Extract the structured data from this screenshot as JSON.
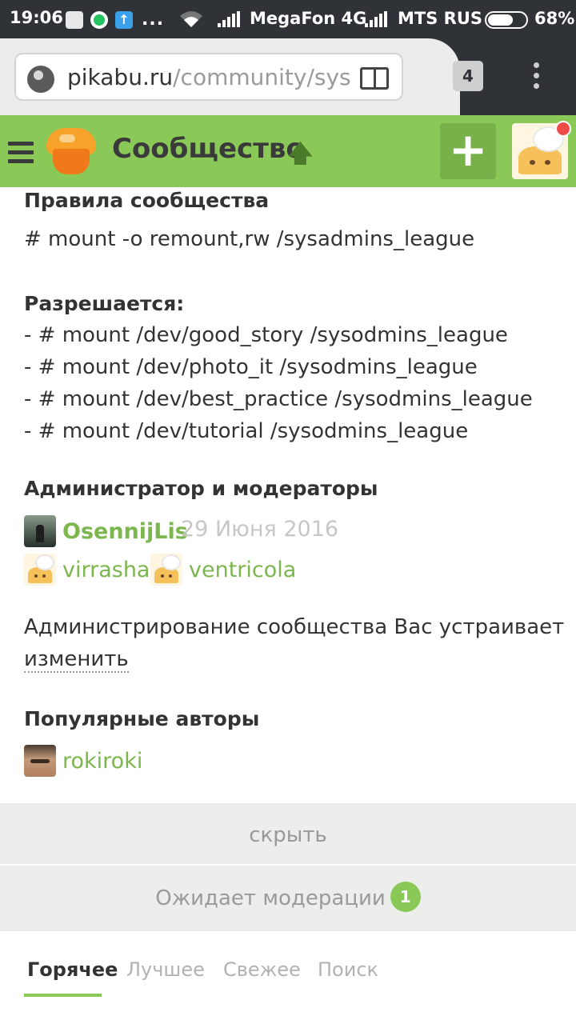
{
  "status_bar": {
    "time": "19:06",
    "more_indicator": "...",
    "operator1": "MegaFon 4G",
    "operator2": "MTS RUS",
    "battery_percent": "68%",
    "battery_level": 0.68
  },
  "browser": {
    "url_host": "pikabu.ru",
    "url_path": "/community/sysc",
    "tab_count": "4"
  },
  "header": {
    "title": "Сообщество",
    "title_arrow": "🡅",
    "add_label": "+"
  },
  "rules": {
    "heading": "Правила сообщества",
    "command": "# mount -o remount,rw /sysadmins_league",
    "allowed_heading": "Разрешается:",
    "allowed_items": [
      "- # mount /dev/good_story /sysodmins_league",
      "- # mount /dev/photo_it /sysodmins_league",
      "- # mount /dev/best_practice /sysodmins_league",
      "- # mount /dev/tutorial /sysodmins_league"
    ]
  },
  "admins": {
    "heading": "Администратор и модераторы",
    "admin": {
      "name": "OsennijLis",
      "date": "29 Июня 2016"
    },
    "moderators": [
      "virrasha",
      "ventricola"
    ],
    "satisfaction_text": "Администрирование сообщества Вас устраивает",
    "change_link": "изменить"
  },
  "popular": {
    "heading": "Популярные авторы",
    "authors": [
      "rokiroki"
    ]
  },
  "panels": {
    "hide_label": "скрыть",
    "moderation_label": "Ожидает модерации",
    "moderation_count": "1"
  },
  "tabs": [
    {
      "label": "Горячее",
      "active": true
    },
    {
      "label": "Лучшее",
      "active": false
    },
    {
      "label": "Свежее",
      "active": false
    },
    {
      "label": "Поиск",
      "active": false
    }
  ],
  "colors": {
    "brand_green": "#8ac858",
    "link_green": "#7cb64e",
    "notification_red": "#ee4b48"
  }
}
